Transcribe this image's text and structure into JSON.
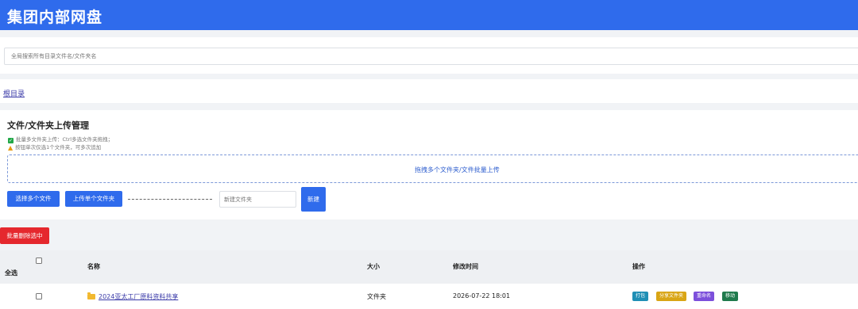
{
  "header": {
    "title": "集团内部网盘"
  },
  "search": {
    "placeholder": "全局搜索所有目录文件名/文件夹名"
  },
  "breadcrumb": {
    "root_label": "根目录"
  },
  "upload": {
    "title": "文件/文件夹上传管理",
    "tip_batch": "批量多文件夹上传：Ctrl多选文件夹拖拽；",
    "tip_limit": "按钮单次仅选1个文件夹，可多次追加",
    "dropzone_text": "拖拽多个文件夹/文件批量上传",
    "select_files_label": "选择多个文件",
    "upload_folder_label": "上传单个文件夹",
    "new_folder_placeholder": "新建文件夹",
    "new_button_label": "新建"
  },
  "toolbar": {
    "batch_delete_label": "批量删除选中"
  },
  "table": {
    "select_all_label": "全选",
    "columns": {
      "name": "名称",
      "size": "大小",
      "modified": "修改时间",
      "actions": "操作"
    },
    "rows": [
      {
        "name": "2024亚太工厂原料资料共享",
        "size": "文件夹",
        "modified": "2026-07-22 18:01",
        "actions": [
          "打包",
          "分享文件夹",
          "重命名",
          "移动"
        ]
      }
    ]
  },
  "colors": {
    "primary": "#2f6bec",
    "danger": "#e5282e",
    "action_pack": "#1f8fb5",
    "action_share": "#d9a515",
    "action_rename": "#7c4fdb",
    "action_move": "#1f7a4c"
  }
}
